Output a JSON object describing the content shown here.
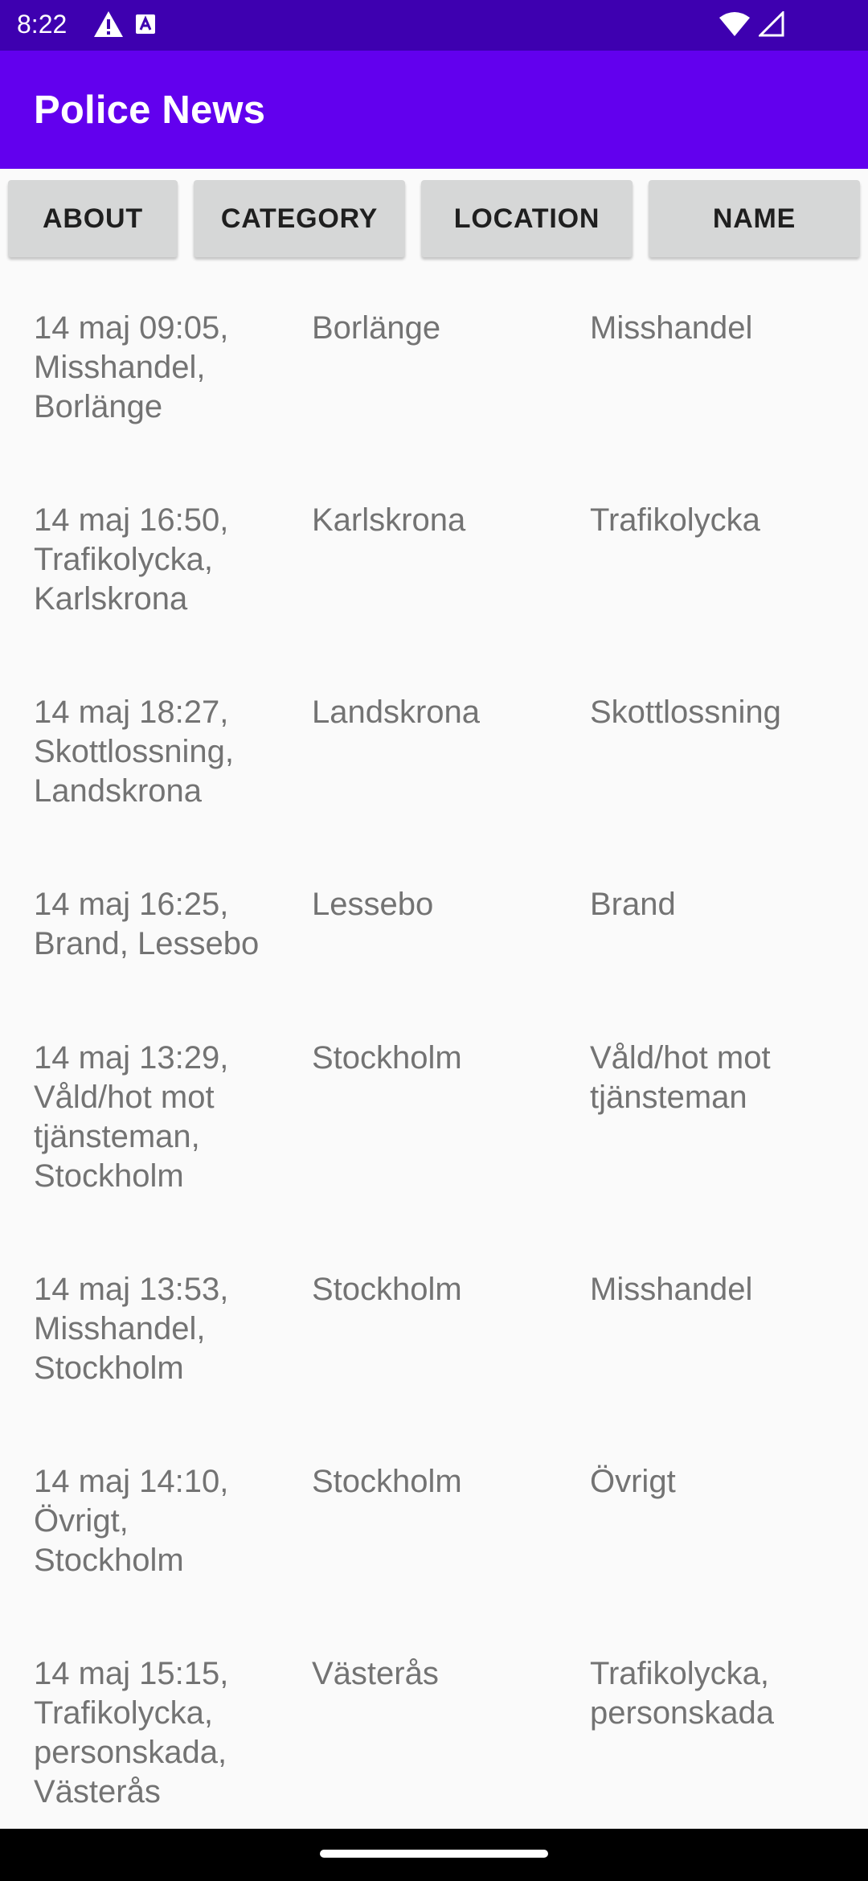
{
  "status_bar": {
    "time": "8:22",
    "icons_left": [
      "alert-icon",
      "a11y-icon"
    ],
    "icons_right": [
      "wifi-icon",
      "signal-icon"
    ]
  },
  "app_bar": {
    "title": "Police News",
    "color": "#6200EE"
  },
  "buttons": {
    "about": "ABOUT",
    "category": "CATEGORY",
    "location": "LOCATION",
    "name": "NAME"
  },
  "news": [
    {
      "title": "14 maj 09:05, Misshandel, Borlänge",
      "location": "Borlänge",
      "category": "Misshandel"
    },
    {
      "title": "14 maj 16:50, Trafikolycka, Karlskrona",
      "location": "Karlskrona",
      "category": "Trafikolycka"
    },
    {
      "title": "14 maj 18:27, Skottlossning, Landskrona",
      "location": "Landskrona",
      "category": "Skottlossning"
    },
    {
      "title": "14 maj 16:25, Brand, Lessebo",
      "location": "Lessebo",
      "category": "Brand"
    },
    {
      "title": "14 maj 13:29, Våld/hot mot tjänsteman, Stockholm",
      "location": "Stockholm",
      "category": "Våld/hot mot tjänsteman"
    },
    {
      "title": "14 maj 13:53, Misshandel, Stockholm",
      "location": "Stockholm",
      "category": "Misshandel"
    },
    {
      "title": "14 maj 14:10, Övrigt, Stockholm",
      "location": "Stockholm",
      "category": "Övrigt"
    },
    {
      "title": "14 maj 15:15, Trafikolycka, personskada, Västerås",
      "location": "Västerås",
      "category": "Trafikolycka, personskada"
    }
  ]
}
